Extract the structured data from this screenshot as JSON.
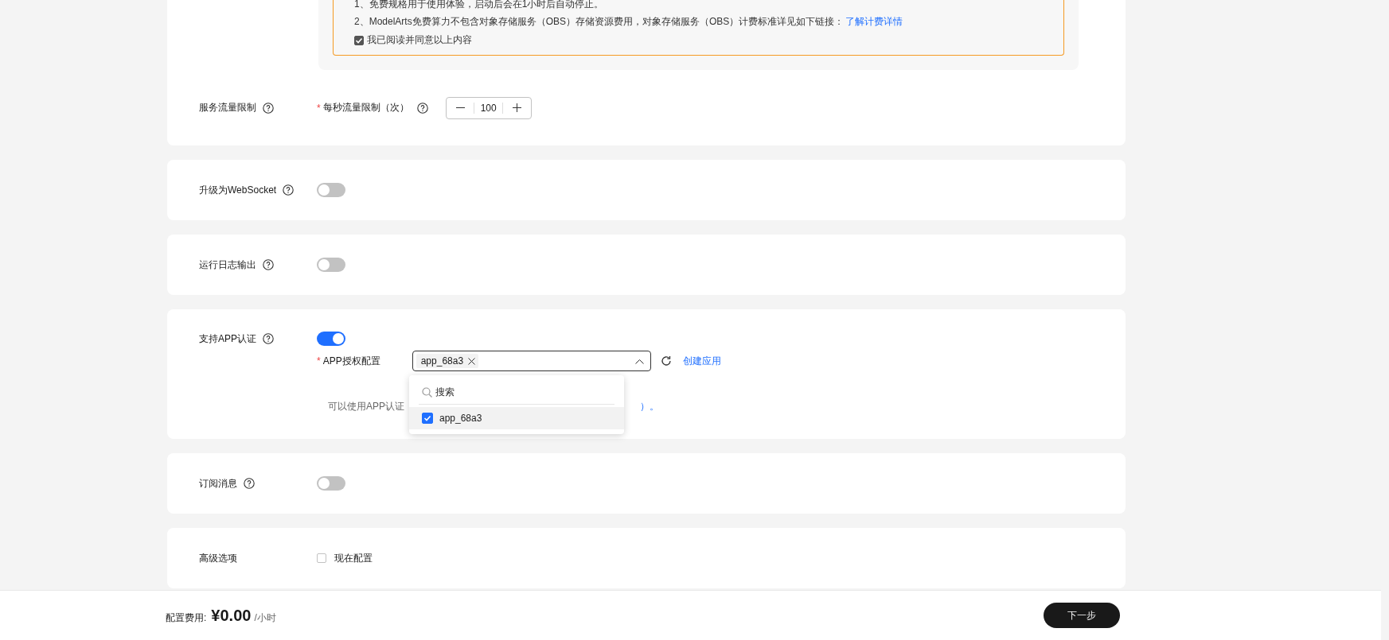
{
  "notice": {
    "lines": [
      {
        "text": "1、免费规格用于使用体验，启动后会在1小时后自动停止。"
      },
      {
        "text": "2、ModelArts免费算力不包含对象存储服务（OBS）存储资源费用，对象存储服务（OBS）计费标准详见如下链接：",
        "link": "了解计费详情"
      }
    ],
    "agree": {
      "label": "我已阅读并同意以上内容",
      "checked": true
    }
  },
  "sections": [
    {
      "kind": "rate",
      "label": "服务流量限制",
      "help": true,
      "field": {
        "label": "每秒流量限制（次）",
        "required_mark": "*",
        "help": true,
        "value": "100"
      }
    },
    {
      "kind": "toggle",
      "label": "升级为WebSocket",
      "help": true,
      "on": false
    },
    {
      "kind": "toggle",
      "label": "运行日志输出",
      "help": true,
      "on": false
    },
    {
      "kind": "app_auth",
      "label": "支持APP认证",
      "help": true,
      "on": true,
      "field": {
        "label": "APP授权配置",
        "required_mark": "*",
        "tags": [
          "app_68a3"
        ],
        "link": "创建应用"
      },
      "help_text": "可以使用APP认证",
      "help_link": "）。",
      "dropdown": {
        "placeholder": "搜索",
        "options": [
          {
            "label": "app_68a3",
            "checked": true
          }
        ]
      }
    },
    {
      "kind": "toggle",
      "label": "订阅消息",
      "help": true,
      "on": false
    },
    {
      "kind": "checkbox",
      "label": "高级选项",
      "help": false,
      "option": "现在配置",
      "checked": false
    }
  ],
  "footer": {
    "cost_label": "配置费用:",
    "price": "¥0.00",
    "unit": "/小时",
    "next": "下一步"
  }
}
